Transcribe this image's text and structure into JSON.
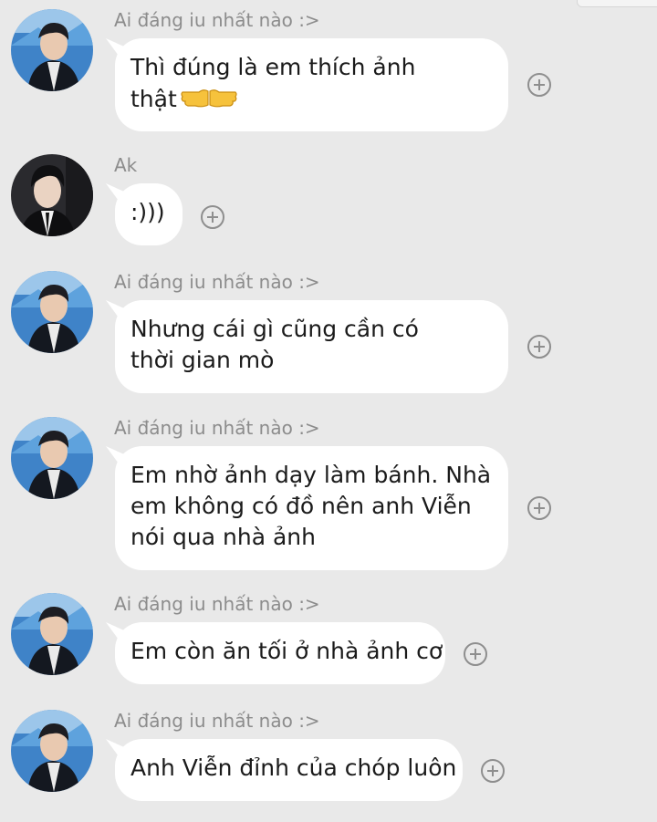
{
  "colors": {
    "background": "#e9e9e9",
    "bubble": "#ffffff",
    "sender_text": "#8c8c8c",
    "message_text": "#1b1b1b",
    "icon_gray": "#8e8e8e"
  },
  "messages": [
    {
      "sender": "Ai đáng iu nhất nào :>",
      "avatar": "avatar-blue-stage",
      "lines": [
        "Thì đúng là em thích ảnh",
        "thật"
      ],
      "emoji": "pointing-hands-emoji",
      "react_icon": "plus-circle-icon"
    },
    {
      "sender": "Ak",
      "avatar": "avatar-dark-suit",
      "lines": [
        ":)))"
      ],
      "react_icon": "plus-circle-icon"
    },
    {
      "sender": "Ai đáng iu nhất nào :>",
      "avatar": "avatar-blue-stage",
      "lines": [
        "Nhưng cái gì cũng cần có",
        "thời gian mò"
      ],
      "react_icon": "plus-circle-icon"
    },
    {
      "sender": "Ai đáng iu nhất nào :>",
      "avatar": "avatar-blue-stage",
      "lines": [
        "Em nhờ ảnh dạy làm bánh. Nhà",
        "em không có đồ nên anh Viễn",
        "nói qua nhà ảnh"
      ],
      "react_icon": "plus-circle-icon"
    },
    {
      "sender": "Ai đáng iu nhất nào :>",
      "avatar": "avatar-blue-stage",
      "lines": [
        "Em còn ăn tối ở nhà ảnh cơ"
      ],
      "react_icon": "plus-circle-icon"
    },
    {
      "sender": "Ai đáng iu nhất nào :>",
      "avatar": "avatar-blue-stage",
      "lines": [
        "Anh Viễn đỉnh của chóp luôn"
      ],
      "react_icon": "plus-circle-icon"
    }
  ]
}
